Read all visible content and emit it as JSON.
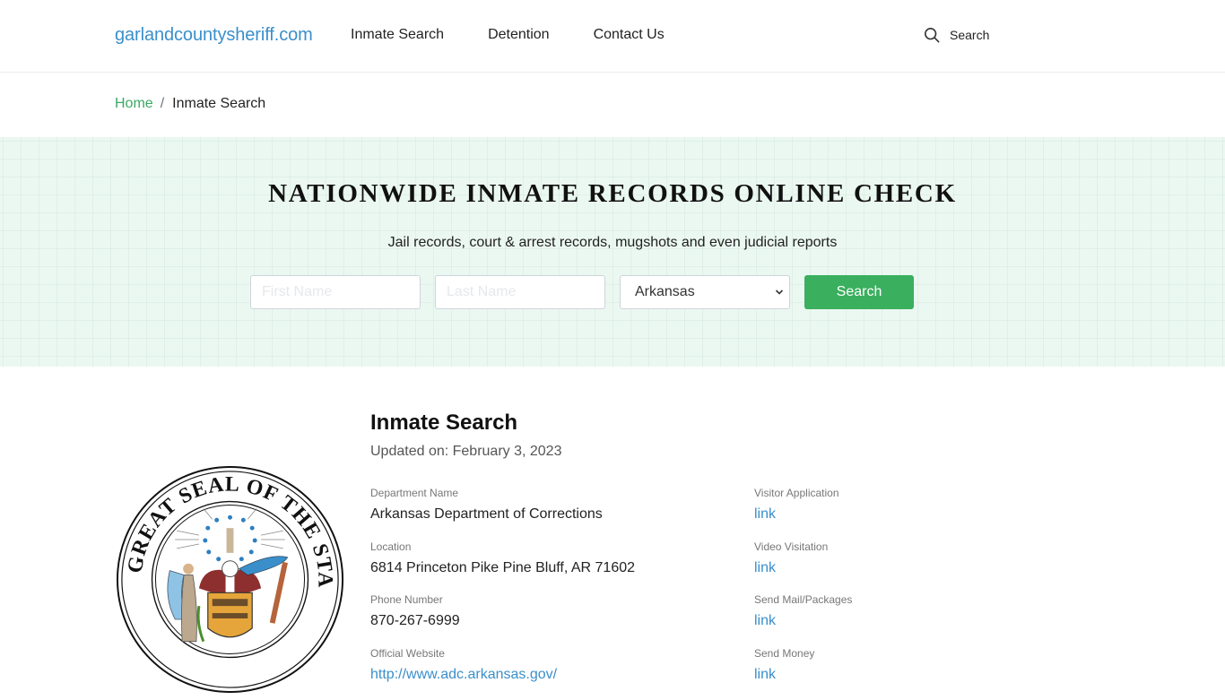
{
  "header": {
    "brand": "garlandcountysheriff.com",
    "nav": [
      {
        "label": "Inmate Search"
      },
      {
        "label": "Detention"
      },
      {
        "label": "Contact Us"
      }
    ],
    "search_label": "Search",
    "search_icon": "search-icon"
  },
  "breadcrumb": {
    "home": "Home",
    "separator": "/",
    "current": "Inmate Search"
  },
  "hero": {
    "title": "NATIONWIDE INMATE RECORDS ONLINE CHECK",
    "subtitle": "Jail records, court & arrest records, mugshots and even judicial reports",
    "first_name_placeholder": "First Name",
    "first_name_value": "",
    "last_name_placeholder": "Last Name",
    "last_name_value": "",
    "state_selected": "Arkansas",
    "search_button": "Search"
  },
  "colors": {
    "brand": "#3a8fcb",
    "breadcrumb_home": "#3aa864",
    "button": "#3aaf5e",
    "hero_bg": "#ebf8f1"
  },
  "content": {
    "title": "Inmate Search",
    "updated": "Updated on: February 3, 2023",
    "seal_text": "GREAT SEAL OF THE STATE OF ARKANSAS",
    "left_fields": [
      {
        "label": "Department Name",
        "value": "Arkansas Department of Corrections"
      },
      {
        "label": "Location",
        "value": "6814 Princeton Pike Pine Bluff, AR 71602"
      },
      {
        "label": "Phone Number",
        "value": "870-267-6999"
      },
      {
        "label": "Official Website",
        "value": "http://www.adc.arkansas.gov/"
      }
    ],
    "right_fields": [
      {
        "label": "Visitor Application",
        "value": "link"
      },
      {
        "label": "Video Visitation",
        "value": "link"
      },
      {
        "label": "Send Mail/Packages",
        "value": "link"
      },
      {
        "label": "Send Money",
        "value": "link"
      }
    ]
  }
}
